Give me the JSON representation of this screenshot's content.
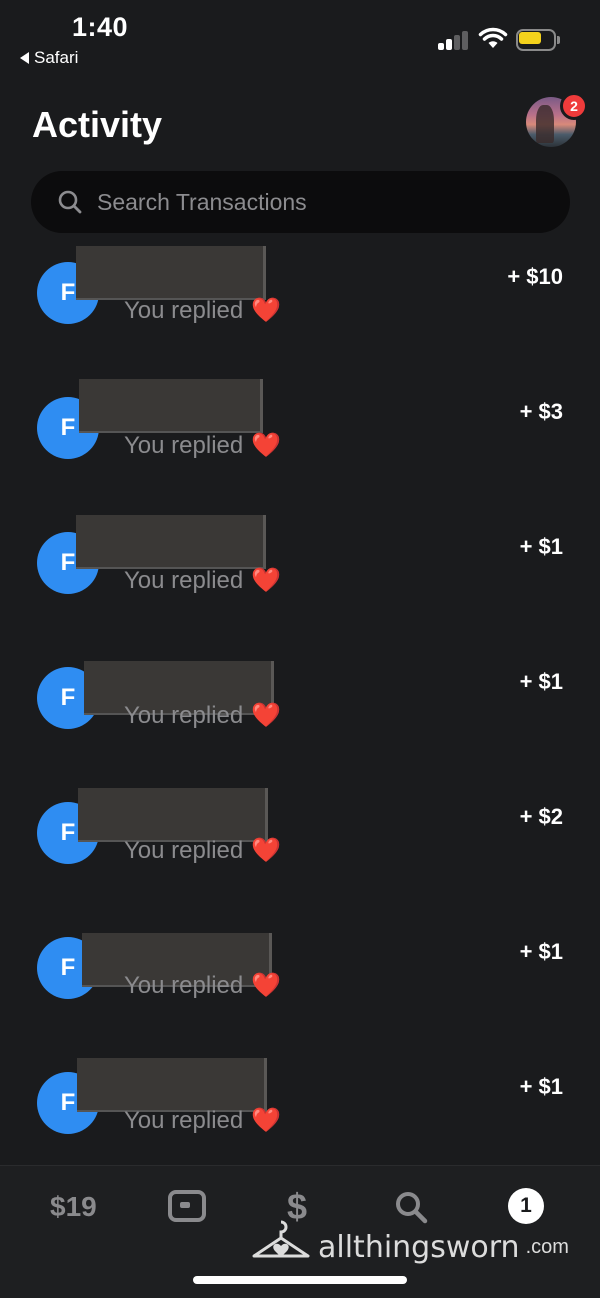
{
  "status_bar": {
    "time": "1:40",
    "back_app": "Safari",
    "battery_color": "#f4d21c"
  },
  "header": {
    "title": "Activity",
    "notification_count": "2",
    "search_placeholder": "Search Transactions"
  },
  "transactions": [
    {
      "initial": "F",
      "subtitle": "You replied",
      "emoji": "❤️",
      "amount": "+ $10"
    },
    {
      "initial": "F",
      "subtitle": "You replied",
      "emoji": "❤️",
      "amount": "+ $3"
    },
    {
      "initial": "F",
      "subtitle": "You replied",
      "emoji": "❤️",
      "amount": "+ $1"
    },
    {
      "initial": "F",
      "subtitle": "You replied",
      "emoji": "❤️",
      "amount": "+ $1"
    },
    {
      "initial": "F",
      "subtitle": "You replied",
      "emoji": "❤️",
      "amount": "+ $2"
    },
    {
      "initial": "F",
      "subtitle": "You replied",
      "emoji": "❤️",
      "amount": "+ $1"
    },
    {
      "initial": "F",
      "subtitle": "You replied",
      "emoji": "❤️",
      "amount": "+ $1"
    }
  ],
  "tab_bar": {
    "balance": "$19",
    "cash_symbol": "$",
    "activity_count": "1"
  },
  "watermark": {
    "text": "allthingsworn",
    "suffix": ".com"
  },
  "colors": {
    "background": "#1a1b1d",
    "accent_blue": "#2f8df2",
    "badge_red": "#ef3b3b"
  }
}
